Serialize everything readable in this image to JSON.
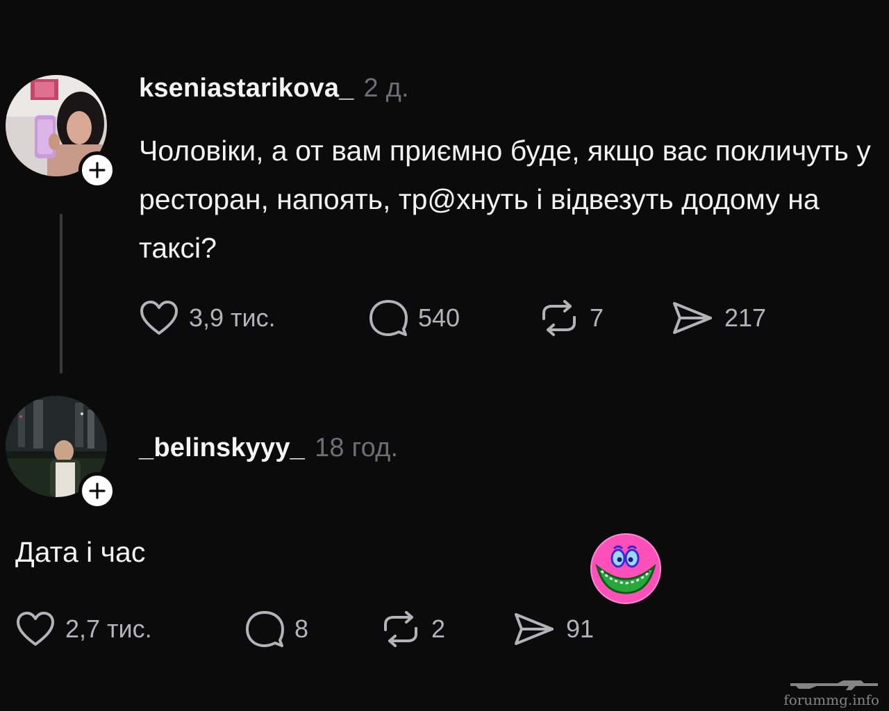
{
  "post": {
    "username": "kseniastarikova_",
    "time": "2 д.",
    "text": "Чоловіки, а от вам приємно буде, якщо вас покличуть у ресторан, напоять, тр@хнуть і відвезуть додому на таксі?",
    "likes": "3,9 тис.",
    "comments": "540",
    "reposts": "7",
    "shares": "217"
  },
  "reply": {
    "username": "_belinskyyy_",
    "time": "18 год.",
    "text": "Дата і час",
    "likes": "2,7 тис.",
    "comments": "8",
    "reposts": "2",
    "shares": "91"
  },
  "watermark": {
    "text": "forummg.info"
  },
  "icons": {
    "like": "heart-icon",
    "comment": "speech-bubble-icon",
    "repost": "repost-icon",
    "share": "send-icon",
    "follow": "plus-icon"
  },
  "colors": {
    "background": "#0b0b0c",
    "text": "#f4f4f4",
    "muted": "#6e6e73",
    "icon": "#b4b4b8"
  }
}
